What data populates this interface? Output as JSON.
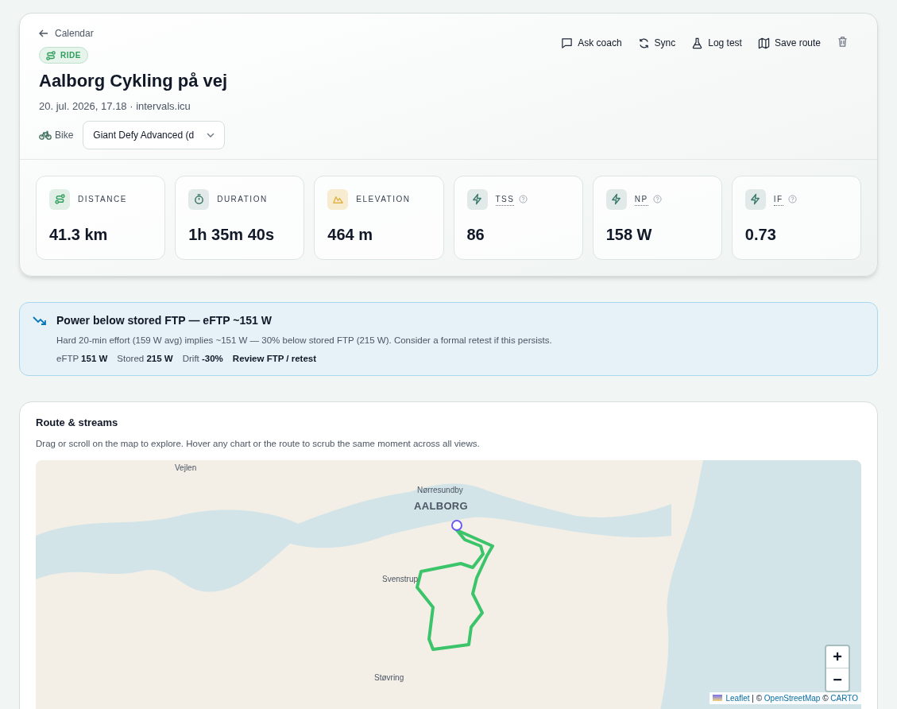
{
  "header": {
    "back_label": "Calendar",
    "sport_badge": "RIDE",
    "title": "Aalborg Cykling på vej",
    "subtitle": "20. jul. 2026, 17.18 · intervals.icu",
    "bike_label": "Bike",
    "bike_value": "Giant Defy Advanced (d",
    "actions": [
      {
        "kind": "chat",
        "label": "Ask coach"
      },
      {
        "kind": "sync",
        "label": "Sync"
      },
      {
        "kind": "flask",
        "label": "Log test"
      },
      {
        "kind": "map",
        "label": "Save route"
      },
      {
        "kind": "trash"
      }
    ]
  },
  "stats": [
    {
      "kind": "route",
      "label": "DISTANCE",
      "value": "41.3 km",
      "has_help": false
    },
    {
      "kind": "timer",
      "label": "DURATION",
      "value": "1h 35m 40s",
      "has_help": false
    },
    {
      "kind": "mountain",
      "label": "ELEVATION",
      "value": "464 m",
      "has_help": false
    },
    {
      "kind": "bolt",
      "label": "TSS",
      "value": "86",
      "has_help": true
    },
    {
      "kind": "bolt",
      "label": "NP",
      "value": "158 W",
      "has_help": true
    },
    {
      "kind": "bolt",
      "label": "IF",
      "value": "0.73",
      "has_help": true
    }
  ],
  "alert": {
    "title": "Power below stored **FTP** — eFTP ~151 W",
    "body": "Hard 20-min effort (159 W avg) implies ~151 W — 30% below stored FTP (215 W). Consider a formal retest if this persists.",
    "facts": [
      {
        "label": "eFTP",
        "value": "151 W"
      },
      {
        "label": "Stored",
        "value": "215 W"
      },
      {
        "label": "Drift",
        "value": "-30%"
      }
    ],
    "link": "Review FTP / retest"
  },
  "route": {
    "title": "Route & streams",
    "hint": "Drag or scroll on the map to explore. Hover any chart or the route to scrub the same moment across all views.",
    "map_labels": [
      {
        "kind": "small",
        "text": "Vejlen"
      },
      {
        "kind": "small",
        "text": "Nørresundby"
      },
      {
        "kind": "city",
        "text": "AALBORG"
      },
      {
        "kind": "small",
        "text": "Svenstrup"
      },
      {
        "kind": "small",
        "text": "Støvring"
      }
    ],
    "zoom_in": "+",
    "zoom_out": "−",
    "attribution": [
      {
        "kind": "link",
        "text": "Leaflet"
      },
      {
        "kind": "text",
        "text": " | © "
      },
      {
        "kind": "link",
        "text": "OpenStreetMap"
      },
      {
        "kind": "text",
        "text": " © "
      },
      {
        "kind": "link",
        "text": "CARTO"
      }
    ]
  }
}
